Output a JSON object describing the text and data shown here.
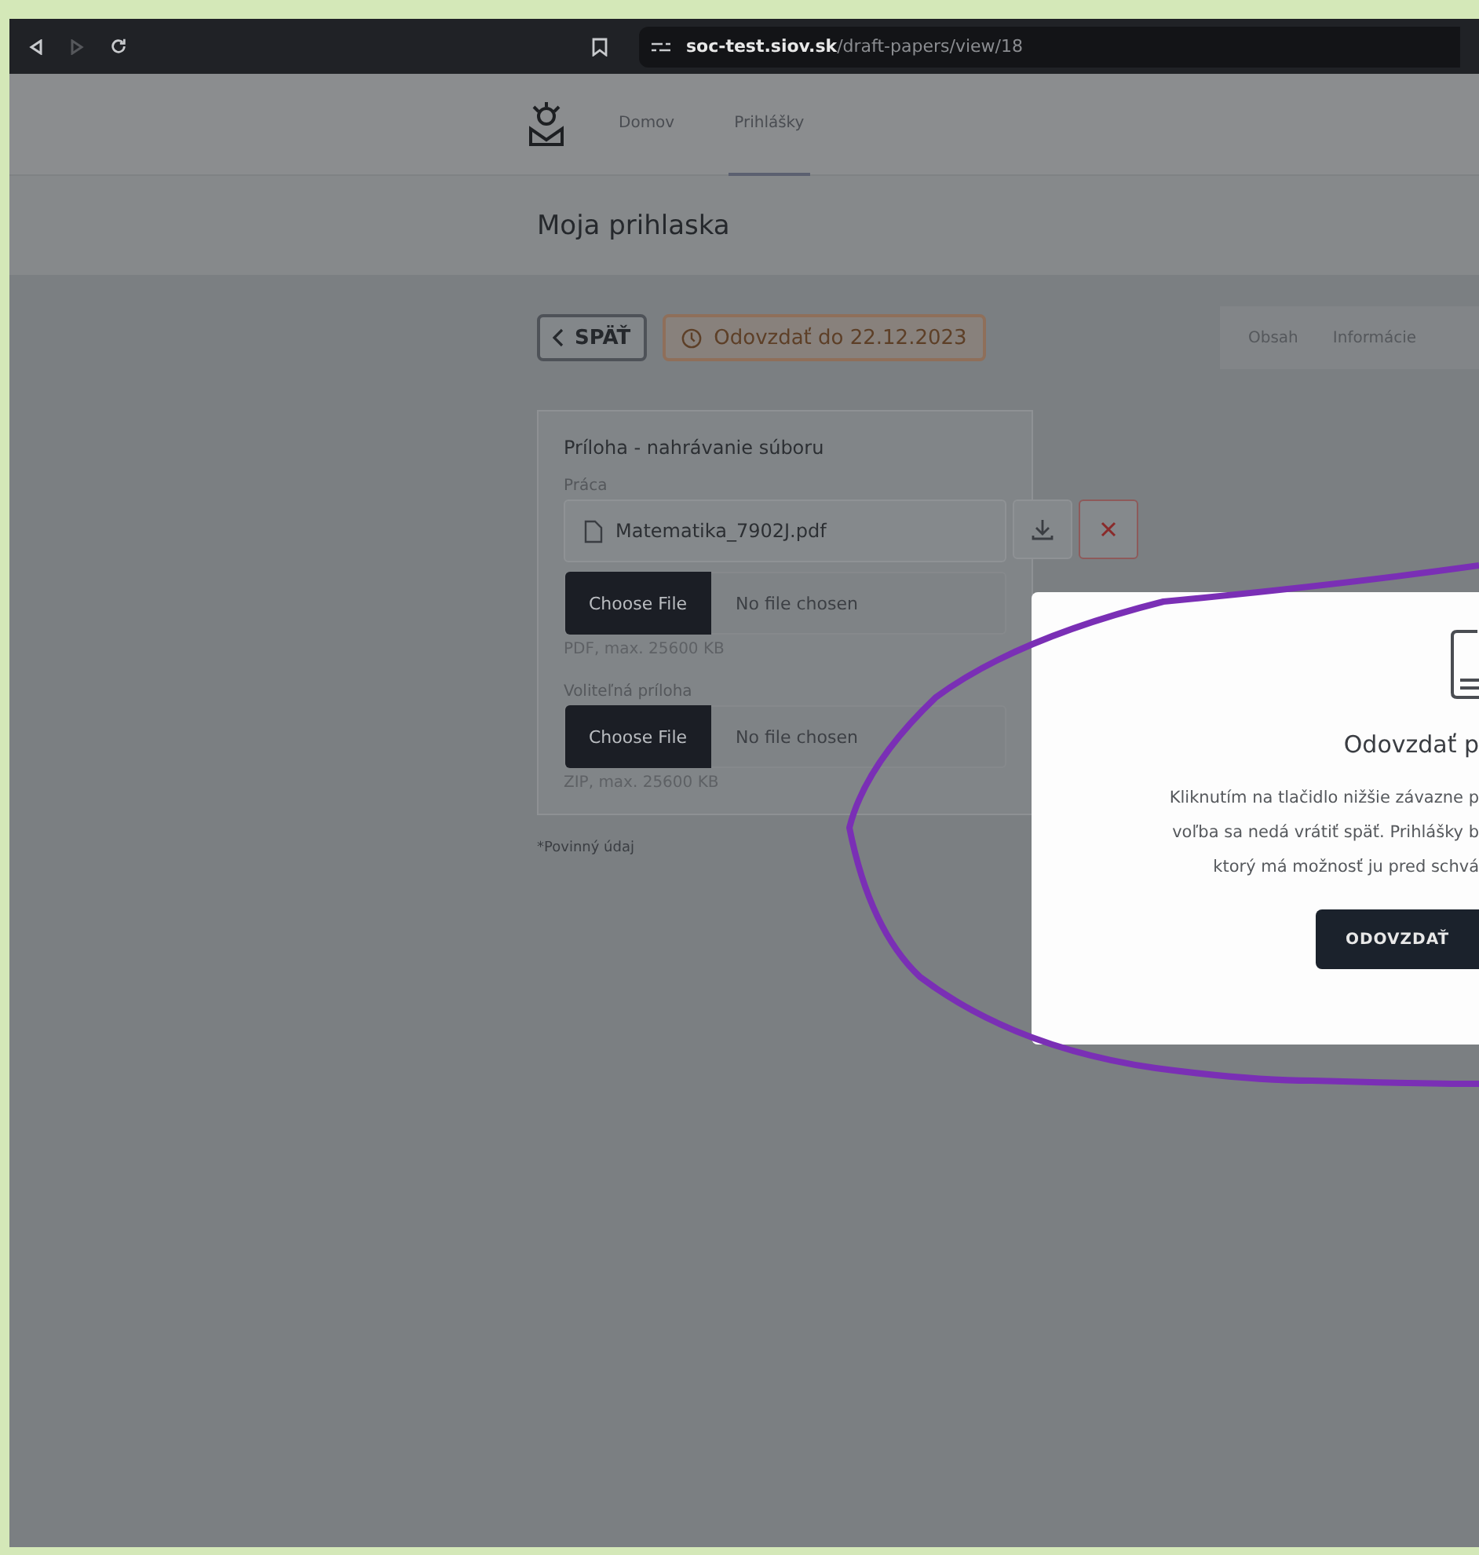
{
  "browser": {
    "url_host": "soc-test.siov.sk",
    "url_path": "/draft-papers/view/18"
  },
  "nav": {
    "items": [
      {
        "label": "Domov",
        "selected": false
      },
      {
        "label": "Prihlášky",
        "selected": true
      }
    ]
  },
  "page_title": "Moja prihlaska",
  "toolbar": {
    "back_label": "SPÄŤ",
    "deadline_label": "Odovzdať do 22.12.2023",
    "tabs": [
      {
        "label": "Obsah"
      },
      {
        "label": "Informácie"
      }
    ]
  },
  "card": {
    "title": "Príloha - nahrávanie súboru",
    "fields": [
      {
        "label": "Práca",
        "uploaded_file": "Matematika_7902J.pdf",
        "input_button": "Choose File",
        "input_status": "No file chosen",
        "hint": "PDF, max. 25600 KB"
      },
      {
        "label": "Voliteľná príloha",
        "input_button": "Choose File",
        "input_status": "No file chosen",
        "hint": "ZIP, max. 25600 KB"
      }
    ]
  },
  "required_note": "*Povinný údaj",
  "dialog": {
    "title": "Odovzdať p",
    "lines": [
      "Kliknutím na tlačidlo nižšie závazne p",
      "voľba sa nedá vrátiť späť. Prihlášky b",
      "ktorý má možnosť ju pred schvá"
    ],
    "button": "ODOVZDAŤ"
  }
}
